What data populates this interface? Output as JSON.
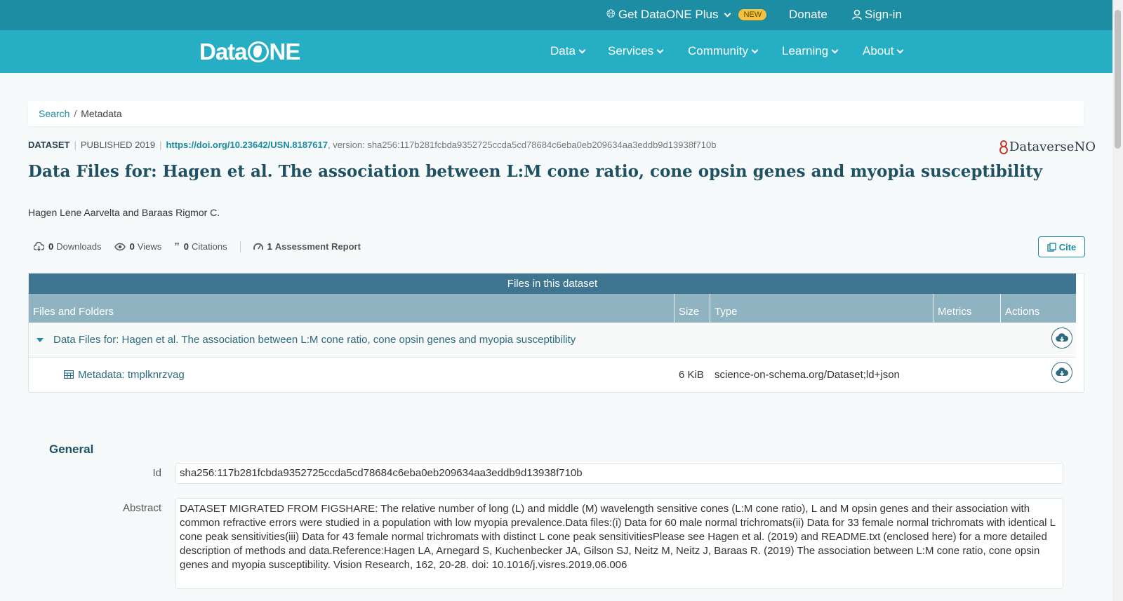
{
  "topbar": {
    "plus_label": "Get DataONE Plus",
    "plus_badge": "NEW",
    "donate_label": "Donate",
    "signin_label": "Sign-in"
  },
  "nav": {
    "logo_left": "Data",
    "logo_right": "NE",
    "items": [
      {
        "label": "Data"
      },
      {
        "label": "Services"
      },
      {
        "label": "Community"
      },
      {
        "label": "Learning"
      },
      {
        "label": "About"
      }
    ]
  },
  "breadcrumb": {
    "search": "Search",
    "separator": "/",
    "current": "Metadata"
  },
  "dataset": {
    "type": "DATASET",
    "published": "PUBLISHED 2019",
    "doi": "https://doi.org/10.23642/USN.8187617",
    "version": ", version: sha256:117b281fcbda9352725ccda5cd78684c6eba0eb209634aa3eddb9d13938f710b",
    "repository": "DataverseNO",
    "title": "Data Files for: Hagen et al. The association between L:M cone ratio, cone opsin genes and myopia susceptibility",
    "authors": "Hagen Lene Aarvelta and Baraas Rigmor C."
  },
  "metrics": {
    "downloads_count": "0",
    "downloads_label": "Downloads",
    "views_count": "0",
    "views_label": "Views",
    "citations_count": "0",
    "citations_label": "Citations",
    "assessment_count": "1",
    "assessment_label": "Assessment Report",
    "cite_label": "Cite"
  },
  "files": {
    "heading": "Files in this dataset",
    "columns": [
      "Files and Folders",
      "Size",
      "Type",
      "Metrics",
      "Actions"
    ],
    "folder_name": "Data Files for: Hagen et al. The association between L:M cone ratio, cone opsin genes and myopia susceptibility",
    "file_name": "Metadata: tmplknrzvag",
    "file_size": "6 KiB",
    "file_type": "science-on-schema.org/Dataset;ld+json"
  },
  "general": {
    "heading": "General",
    "id_label": "Id",
    "id_value": "sha256:117b281fcbda9352725ccda5cd78684c6eba0eb209634aa3eddb9d13938f710b",
    "abstract_label": "Abstract",
    "abstract_value": "DATASET MIGRATED FROM FIGSHARE: The relative number of long (L) and middle (M) wavelength sensitive cones (L:M cone ratio), L and M opsin genes and their association with common refractive errors were studied in a population with low myopia prevalence.Data files:(i) Data for 60 male normal trichromats(ii) Data for 33 female normal trichromats with identical L cone peak sensitivities(iii) Data for 43 female normal trichromats with distinct L cone peak sensitivitiesPlease see Hagen et al. (2019) and README.txt (enclosed here) for a more detailed description of methods and data.Reference:Hagen LA, Arnegard S, Kuchenbecker JA, Gilson SJ, Neitz M, Neitz J, Baraas R. (2019) The association between L:M cone ratio, cone opsin genes and myopia susceptibility. Vision Research, 162, 20-28. doi: 10.1016/j.visres.2019.06.006"
  },
  "colors": {
    "topbar": "#1c8da3",
    "navbar": "#26aec4",
    "accent": "#1a8ca0",
    "title": "#1f5163",
    "table_head": "#3f7591",
    "table_cols": "#8fb3c1"
  }
}
